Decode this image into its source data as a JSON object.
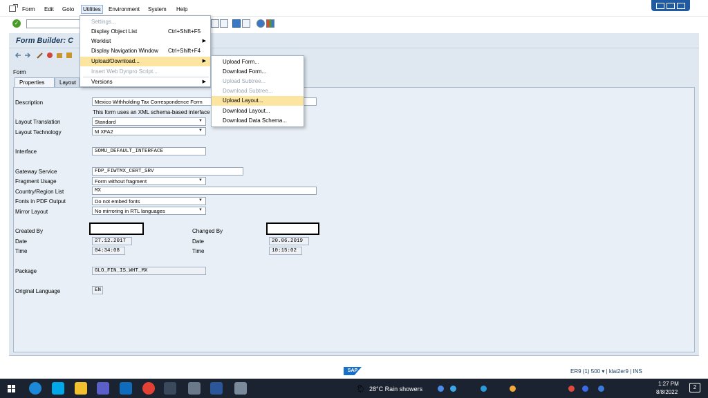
{
  "menubar": {
    "items": [
      "Form",
      "Edit",
      "Goto",
      "Utilities",
      "Environment",
      "System",
      "Help"
    ]
  },
  "title": "Form Builder: C",
  "form_label": "Form",
  "tabs": [
    "Properties",
    "Layout"
  ],
  "fields": {
    "description_label": "Description",
    "description_value": "Mexico Withholding Tax Correspondence Form",
    "schema_note": "This form uses an XML schema-based interface",
    "layout_translation_label": "Layout Translation",
    "layout_translation_value": "Standard",
    "layout_technology_label": "Layout Technology",
    "layout_technology_value": "M XFA2",
    "interface_label": "Interface",
    "interface_value": "SOMU_DEFAULT_INTERFACE",
    "gateway_label": "Gateway Service",
    "gateway_value": "FDP_FIWTMX_CERT_SRV",
    "fragment_label": "Fragment Usage",
    "fragment_value": "Form without fragment",
    "country_label": "Country/Region List",
    "country_value": "MX",
    "fonts_label": "Fonts in PDF Output",
    "fonts_value": "Do not embed fonts",
    "mirror_label": "Mirror Layout",
    "mirror_value": "No mirroring in RTL languages",
    "created_by_label": "Created By",
    "changed_by_label": "Changed By",
    "date_label": "Date",
    "created_date": "27.12.2017",
    "changed_date": "20.06.2019",
    "time_label": "Time",
    "created_time": "04:34:08",
    "changed_time": "10:15:02",
    "package_label": "Package",
    "package_value": "GLO_FIN_IS_WHT_MX",
    "language_label": "Original Language",
    "language_value": "EN"
  },
  "utilities_menu": {
    "items": [
      {
        "label": "Settings...",
        "shortcut": "",
        "disabled": true
      },
      {
        "label": "Display Object List",
        "shortcut": "Ctrl+Shift+F5",
        "disabled": false
      },
      {
        "label": "Worklist",
        "shortcut": "",
        "disabled": false
      },
      {
        "label": "Display Navigation Window",
        "shortcut": "Ctrl+Shift+F4",
        "disabled": false
      },
      {
        "label": "Upload/Download...",
        "shortcut": "",
        "disabled": false
      },
      {
        "label": "Insert Web Dynpro Script...",
        "shortcut": "",
        "disabled": true
      },
      {
        "label": "Versions",
        "shortcut": "",
        "disabled": false
      }
    ]
  },
  "upload_submenu": {
    "items": [
      {
        "label": "Upload Form...",
        "disabled": false
      },
      {
        "label": "Download Form...",
        "disabled": false
      },
      {
        "label": "Upload Subtree...",
        "disabled": true
      },
      {
        "label": "Download Subtree...",
        "disabled": true
      },
      {
        "label": "Upload Layout...",
        "disabled": false
      },
      {
        "label": "Download Layout...",
        "disabled": false
      },
      {
        "label": "Download Data Schema...",
        "disabled": false
      }
    ]
  },
  "statusbar": {
    "logo": "SAP",
    "system_info": "ER9 (1) 500 ▾ | klai2er9 | INS"
  },
  "taskbar": {
    "weather": "28°C Rain showers",
    "time": "1:27 PM",
    "date": "8/8/2022",
    "notifications": "2"
  },
  "colors": {
    "accent": "#1f5aa3",
    "panel": "#dfe8f1",
    "highlight": "#fbe5a0",
    "taskbar": "#1b2330"
  }
}
